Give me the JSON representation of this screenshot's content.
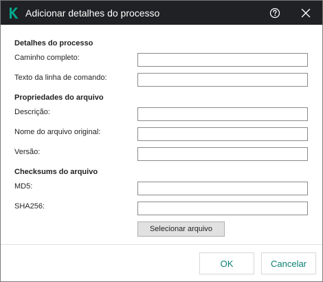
{
  "window": {
    "title": "Adicionar detalhes do processo",
    "logo_icon": "kaspersky-k-logo",
    "accent_color": "#00a88e",
    "titlebar_color": "#202124"
  },
  "sections": {
    "process_details": {
      "heading": "Detalhes do processo",
      "full_path_label": "Caminho completo:",
      "full_path_value": "",
      "command_line_label": "Texto da linha de comando:",
      "command_line_value": ""
    },
    "file_properties": {
      "heading": "Propriedades do arquivo",
      "description_label": "Descrição:",
      "description_value": "",
      "original_name_label": "Nome do arquivo original:",
      "original_name_value": "",
      "version_label": "Versão:",
      "version_value": ""
    },
    "checksums": {
      "heading": "Checksums do arquivo",
      "md5_label": "MD5:",
      "md5_value": "",
      "sha256_label": "SHA256:",
      "sha256_value": "",
      "select_file_label": "Selecionar arquivo"
    }
  },
  "footer": {
    "ok_label": "OK",
    "cancel_label": "Cancelar"
  }
}
